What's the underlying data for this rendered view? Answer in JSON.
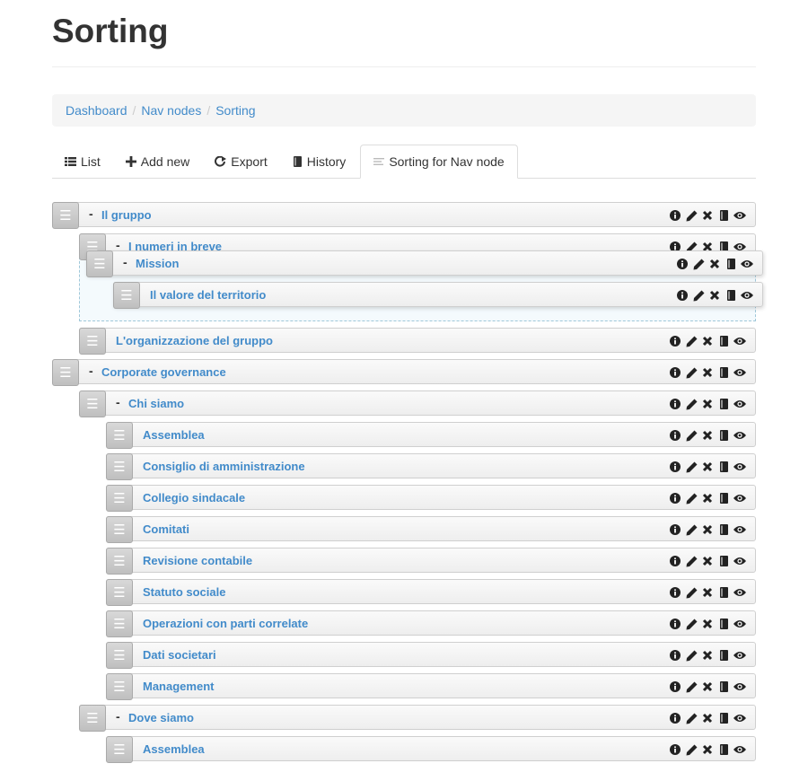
{
  "page": {
    "title": "Sorting"
  },
  "breadcrumb": [
    "Dashboard",
    "Nav nodes",
    "Sorting"
  ],
  "tabs": [
    {
      "label": "List",
      "icon": "list-icon"
    },
    {
      "label": "Add new",
      "icon": "plus-icon"
    },
    {
      "label": "Export",
      "icon": "export-icon"
    },
    {
      "label": "History",
      "icon": "book-icon"
    },
    {
      "label": "Sorting for Nav node",
      "icon": "sort-icon",
      "active": true
    }
  ],
  "handle_glyph": "☰",
  "collapse_glyph": "-",
  "colors": {
    "link": "#428bca",
    "handle": "#c9c9c9",
    "placeholder_border": "#9fc7d9"
  },
  "tree": [
    {
      "label": "Il gruppo",
      "collapsible": true
    },
    {
      "label": "I numeri in breve",
      "collapsible": true,
      "partially_hidden": true
    },
    {
      "label": "Mission",
      "collapsible": true,
      "dragging": true
    },
    {
      "label": "Il valore del territorio",
      "collapsible": false,
      "dragging": true
    },
    {
      "label": "L'organizzazione del gruppo",
      "collapsible": false
    },
    {
      "label": "Corporate governance",
      "collapsible": true
    },
    {
      "label": "Chi siamo",
      "collapsible": true
    },
    {
      "label": "Assemblea",
      "collapsible": false
    },
    {
      "label": "Consiglio di amministrazione",
      "collapsible": false
    },
    {
      "label": "Collegio sindacale",
      "collapsible": false
    },
    {
      "label": "Comitati",
      "collapsible": false
    },
    {
      "label": "Revisione contabile",
      "collapsible": false
    },
    {
      "label": "Statuto sociale",
      "collapsible": false
    },
    {
      "label": "Operazioni con parti correlate",
      "collapsible": false
    },
    {
      "label": "Dati societari",
      "collapsible": false
    },
    {
      "label": "Management",
      "collapsible": false
    },
    {
      "label": "Dove siamo",
      "collapsible": true
    },
    {
      "label": "Assemblea",
      "collapsible": false
    }
  ],
  "row_actions": [
    "info-icon",
    "edit-icon",
    "delete-icon",
    "book-icon",
    "eye-icon"
  ]
}
